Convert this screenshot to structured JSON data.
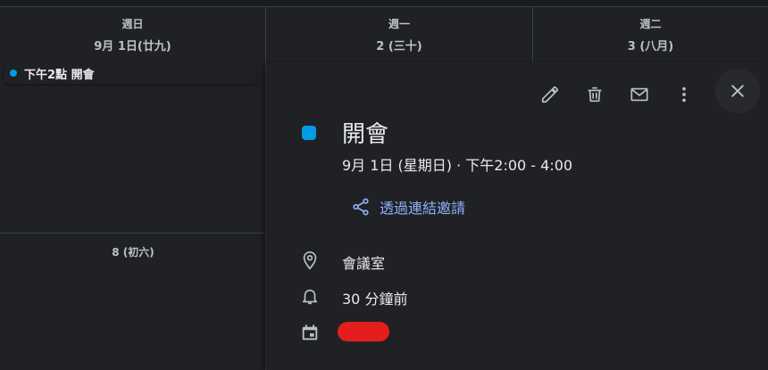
{
  "calendar": {
    "days": [
      {
        "name": "週日",
        "date": "9月 1日(廿九)"
      },
      {
        "name": "週一",
        "date": "2 (三十)"
      },
      {
        "name": "週二",
        "date": "3 (八月)"
      }
    ],
    "event_chip": "下午2點 開會",
    "week2_date": "8 (初六)"
  },
  "popup": {
    "title": "開會",
    "datetime": "9月 1日 (星期日)  ·  下午2:00 - 4:00",
    "invite_link": "透過連結邀請",
    "location": "會議室",
    "reminder": "30 分鐘前",
    "calendar_owner": "",
    "event_color": "#039be5",
    "link_color": "#8ab4f8",
    "redaction_color": "#e41e1e"
  },
  "icons": {
    "edit": "pencil-icon",
    "delete": "trash-icon",
    "email": "envelope-icon",
    "more": "more-vert-icon",
    "close": "close-icon",
    "share": "share-icon",
    "location": "location-pin-icon",
    "reminder": "bell-icon",
    "calendar": "calendar-icon"
  }
}
